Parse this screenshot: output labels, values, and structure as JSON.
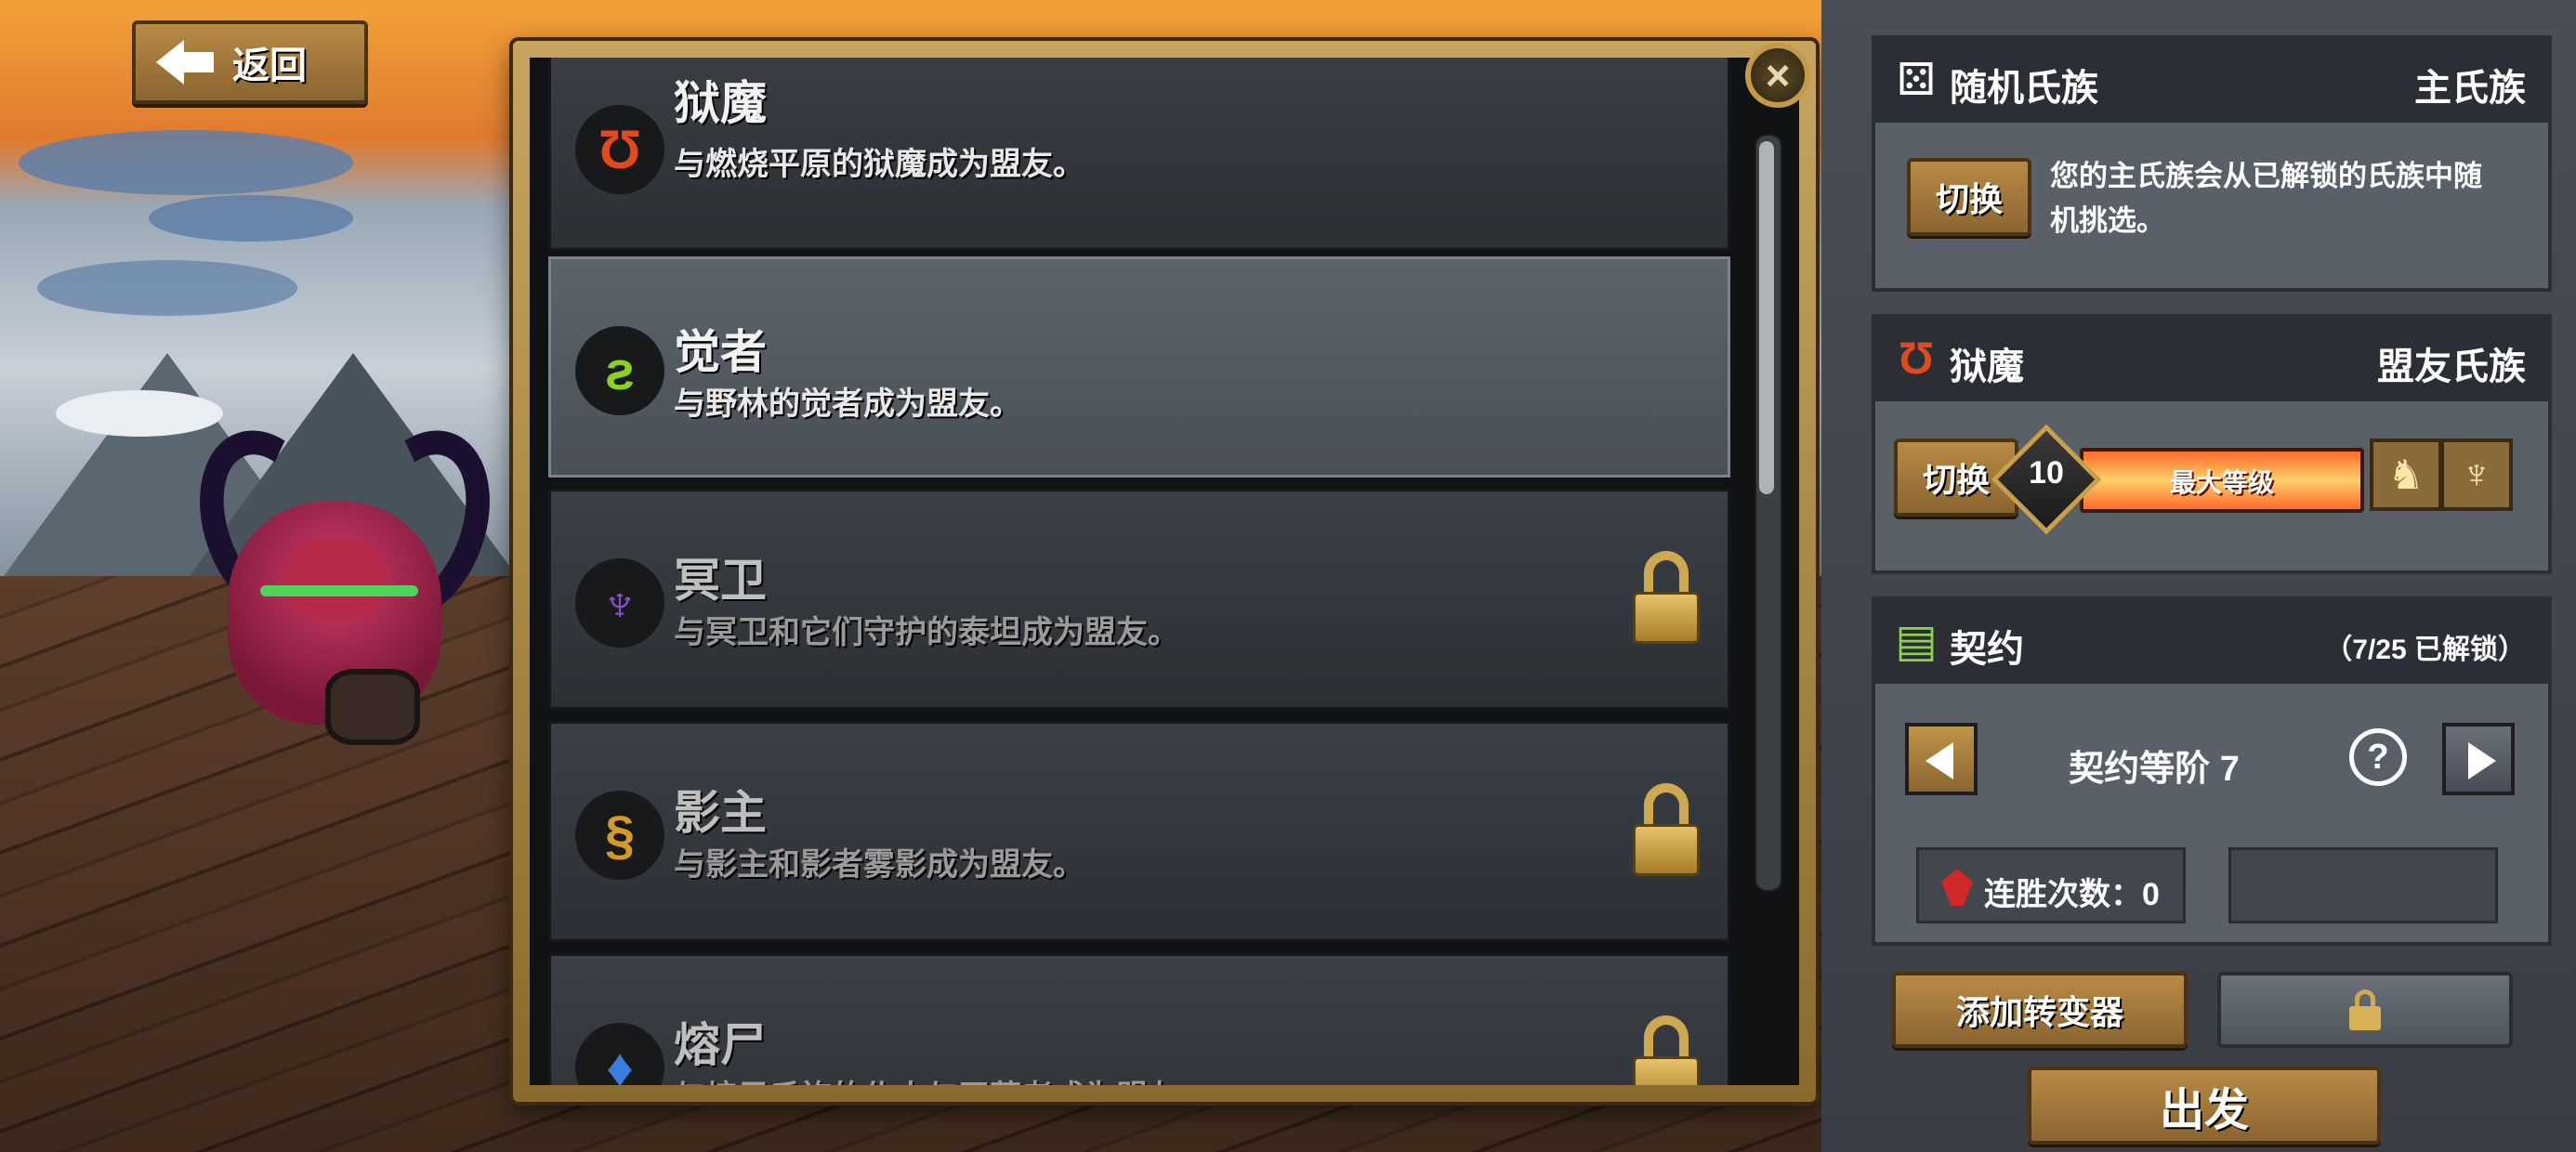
{
  "nav": {
    "back_label": "返回"
  },
  "clans": [
    {
      "name": "狱魔",
      "desc": "与燃烧平原的狱魔成为盟友。",
      "icon": "inferno-clan-icon",
      "locked": false,
      "selected": false,
      "color": "#e04a1c",
      "glyph": "Ʊ"
    },
    {
      "name": "觉者",
      "desc": "与野林的觉者成为盟友。",
      "icon": "awakened-clan-icon",
      "locked": false,
      "selected": true,
      "color": "#8bd21e",
      "glyph": "ƨ"
    },
    {
      "name": "冥卫",
      "desc": "与冥卫和它们守护的泰坦成为盟友。",
      "icon": "warden-clan-icon",
      "locked": true,
      "selected": false,
      "color": "#8a4fd0",
      "glyph": "♆"
    },
    {
      "name": "影主",
      "desc": "与影主和影者雾影成为盟友。",
      "icon": "shadow-clan-icon",
      "locked": true,
      "selected": false,
      "color": "#d49b2a",
      "glyph": "§"
    },
    {
      "name": "熔尸",
      "desc": "与熔尸氏族的仆人与王莽者成为盟友。",
      "icon": "molten-clan-icon",
      "locked": true,
      "selected": false,
      "color": "#3a7ee0",
      "glyph": "♦"
    }
  ],
  "random_clan": {
    "title": "随机氏族",
    "role": "主氏族",
    "switch_label": "切换",
    "description_line1": "您的主氏族会从已解锁的氏族中随",
    "description_line2": "机挑选。"
  },
  "ally_clan": {
    "title": "狱魔",
    "role": "盟友氏族",
    "switch_label": "切换",
    "level": "10",
    "level_text": "最大等级",
    "progress": 1.0
  },
  "contract": {
    "title": "契约",
    "unlocked": "（7/25 已解锁）",
    "tier_label": "契约等阶 7",
    "help": "?",
    "win_streak": "连胜次数：0"
  },
  "actions": {
    "add_mutator": "添加转变器",
    "depart": "出发"
  },
  "colors": {
    "gold_button": "#a47a3c",
    "panel_dark": "#2b2f35",
    "accent_fire": "#ff6a2a"
  }
}
